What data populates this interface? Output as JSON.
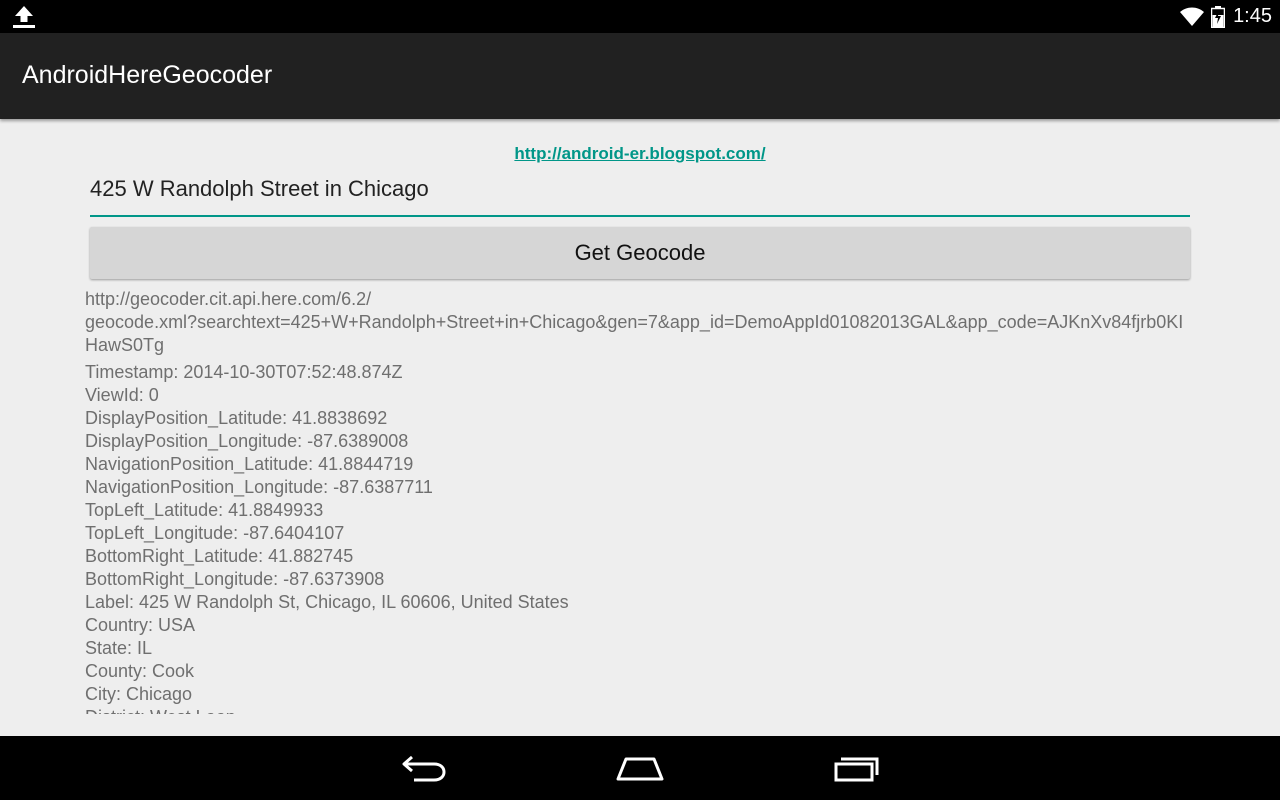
{
  "status_bar": {
    "time": "1:45",
    "icons": [
      "upload-icon",
      "wifi-icon",
      "battery-charging-icon"
    ]
  },
  "action_bar": {
    "title": "AndroidHereGeocoder"
  },
  "main": {
    "link_text": "http://android-er.blogspot.com/",
    "search_value": "425 W Randolph Street in Chicago",
    "button_label": "Get Geocode",
    "request_url": "http://geocoder.cit.api.here.com/6.2/\ngeocode.xml?searchtext=425+W+Randolph+Street+in+Chicago&gen=7&app_id=DemoAppId01082013GAL&app_code=AJKnXv84fjrb0KIHawS0Tg",
    "results": [
      "Timestamp: 2014-10-30T07:52:48.874Z",
      "ViewId: 0",
      "DisplayPosition_Latitude: 41.8838692",
      "DisplayPosition_Longitude: -87.6389008",
      "NavigationPosition_Latitude: 41.8844719",
      "NavigationPosition_Longitude: -87.6387711",
      "TopLeft_Latitude: 41.8849933",
      "TopLeft_Longitude: -87.6404107",
      "BottomRight_Latitude: 41.882745",
      "BottomRight_Longitude: -87.6373908",
      "Label: 425 W Randolph St, Chicago, IL 60606, United States",
      "Country: USA",
      "State: IL",
      "County: Cook",
      "City: Chicago",
      "District: West Loop"
    ]
  },
  "nav_bar": {
    "icons": [
      "back-icon",
      "home-icon",
      "recents-icon"
    ]
  },
  "colors": {
    "accent": "#009688",
    "action_bar": "#212121",
    "background": "#eeeeee"
  }
}
